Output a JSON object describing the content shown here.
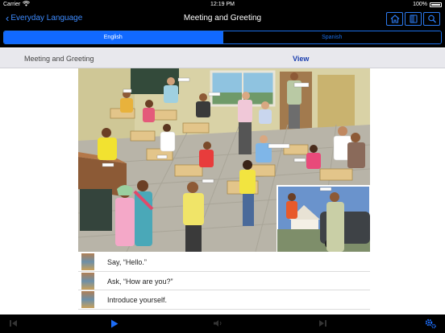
{
  "status_bar": {
    "carrier": "Carrier",
    "time": "12:19 PM",
    "battery": "100%"
  },
  "nav": {
    "back_label": "Everyday Language",
    "title": "Meeting and Greeting",
    "icons": [
      "home-icon",
      "book-icon",
      "search-icon"
    ]
  },
  "segments": {
    "english": "English",
    "spanish": "Spanish",
    "selected": "English"
  },
  "section": {
    "title": "Meeting and Greeting",
    "view_label": "View"
  },
  "phrases": [
    {
      "text": "Say, “Hello.”"
    },
    {
      "text": "Ask, “How are you?”"
    },
    {
      "text": "Introduce yourself."
    }
  ],
  "toolbar": {
    "icons": [
      "rewind-icon",
      "play-icon",
      "volume-icon",
      "fast-forward-icon",
      "settings-icon"
    ],
    "active_color": "#1d6cf5",
    "disabled_color": "#333333"
  },
  "colors": {
    "accent": "#1169ff",
    "link": "#3d8bff",
    "view_link": "#1b3fae"
  }
}
